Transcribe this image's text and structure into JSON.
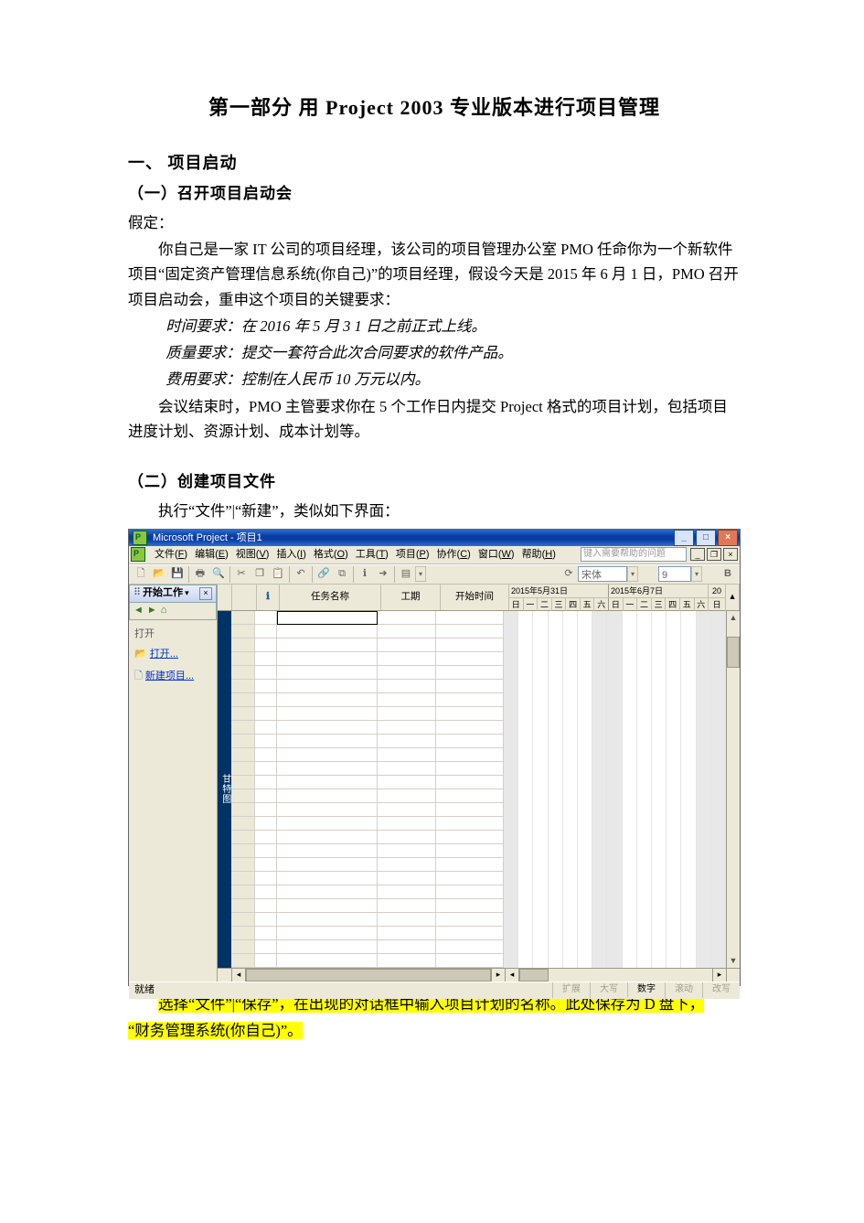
{
  "doc": {
    "title": "第一部分  用 Project 2003 专业版本进行项目管理",
    "h1_1": "一、 项目启动",
    "h2_1": "（一）召开项目启动会",
    "p_assume": "假定：",
    "p1": "你自己是一家 IT 公司的项目经理，该公司的项目管理办公室 PMO 任命你为一个新软件项目“固定资产管理信息系统(你自己)”的项目经理，假设今天是 2015 年 6 月 1 日，PMO 召开项目启动会，重申这个项目的关键要求：",
    "p_time": "时间要求：在 2016 年 5 月 3 1 日之前正式上线。",
    "p_qual": "质量要求：提交一套符合此次合同要求的软件产品。",
    "p_cost": "费用要求：控制在人民币 10 万元以内。",
    "p_meet": "会议结束时，PMO 主管要求你在 5 个工作日内提交 Project 格式的项目计划，包括项目进度计划、资源计划、成本计划等。",
    "h2_2": "（二）创建项目文件",
    "p_exec": "执行“文件”|“新建”，类似如下界面：",
    "p_hi1": "选择“文件”|“保存”，在出现的对话框中输入项目计划的名称。此处保存为 D 盘下，",
    "p_hi2": "“财务管理系统(你自己)”。"
  },
  "app": {
    "title": "Microsoft Project - 项目1",
    "menu": {
      "file": {
        "t": "文件",
        "k": "F"
      },
      "edit": {
        "t": "编辑",
        "k": "E"
      },
      "view": {
        "t": "视图",
        "k": "V"
      },
      "insert": {
        "t": "插入",
        "k": "I"
      },
      "format": {
        "t": "格式",
        "k": "O"
      },
      "tools": {
        "t": "工具",
        "k": "T"
      },
      "project": {
        "t": "项目",
        "k": "P"
      },
      "collab": {
        "t": "协作",
        "k": "C"
      },
      "window": {
        "t": "窗口",
        "k": "W"
      },
      "help": {
        "t": "帮助",
        "k": "H"
      }
    },
    "question_hint": "键入需要帮助的问题",
    "font_name": "宋体",
    "font_size": "9",
    "bold_label": "B",
    "pane": {
      "title": "开始工作",
      "open_heading": "打开",
      "open_link": "打开...",
      "new_link": "新建项目..."
    },
    "grid": {
      "col_info": "ℹ",
      "col_name": "任务名称",
      "col_dur": "工期",
      "col_start": "开始时间",
      "week1": "2015年5月31日",
      "week2": "2015年6月7日",
      "days": [
        "日",
        "一",
        "二",
        "三",
        "四",
        "五",
        "六"
      ]
    },
    "view_strip": "甘特图",
    "status": {
      "left": "就绪",
      "ext": "扩展",
      "caps": "大写",
      "num": "数字",
      "scrl": "滚动",
      "ovr": "改写"
    }
  }
}
